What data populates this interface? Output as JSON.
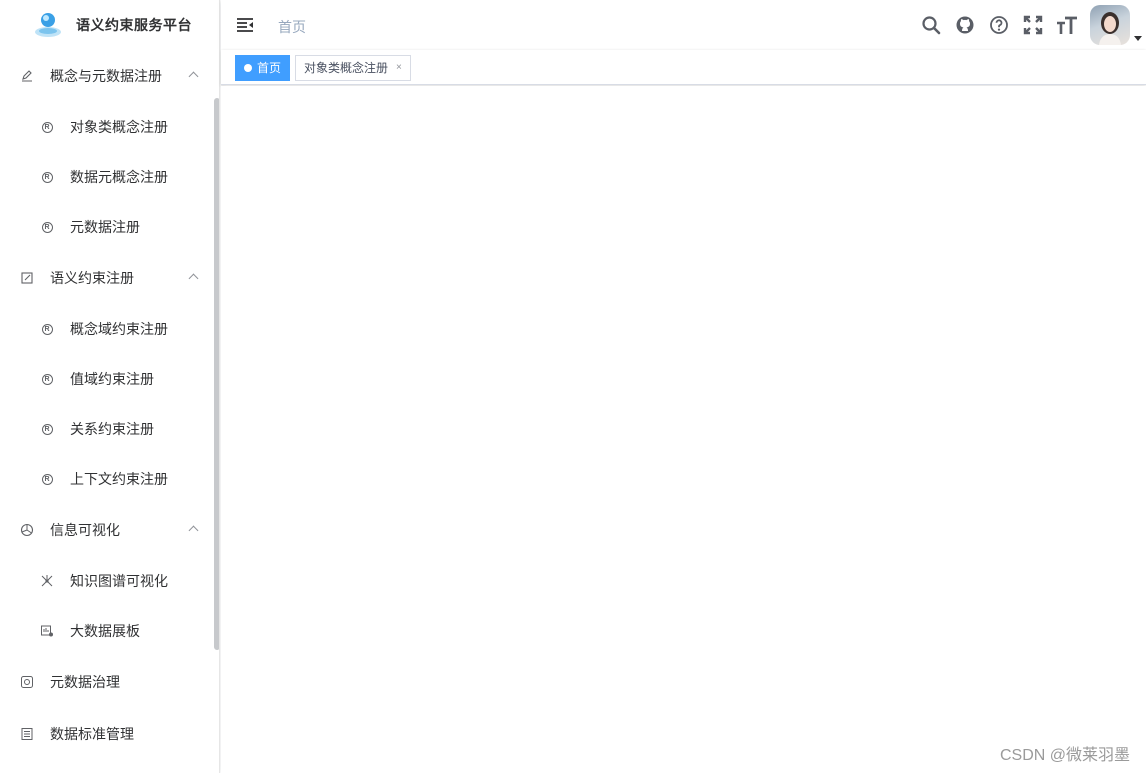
{
  "app": {
    "title": "语义约束服务平台"
  },
  "sidebar": {
    "groups": [
      {
        "label": "概念与元数据注册",
        "items": [
          {
            "label": "对象类概念注册"
          },
          {
            "label": "数据元概念注册"
          },
          {
            "label": "元数据注册"
          }
        ]
      },
      {
        "label": "语义约束注册",
        "items": [
          {
            "label": "概念域约束注册"
          },
          {
            "label": "值域约束注册"
          },
          {
            "label": "关系约束注册"
          },
          {
            "label": "上下文约束注册"
          }
        ]
      },
      {
        "label": "信息可视化",
        "items": [
          {
            "label": "知识图谱可视化"
          },
          {
            "label": "大数据展板"
          }
        ]
      },
      {
        "label": "元数据治理"
      },
      {
        "label": "数据标准管理"
      }
    ]
  },
  "navbar": {
    "breadcrumb": "首页",
    "icons": [
      "search-icon",
      "github-icon",
      "help-icon",
      "fullscreen-icon",
      "font-size-icon"
    ]
  },
  "tags": [
    {
      "label": "首页",
      "active": true
    },
    {
      "label": "对象类概念注册",
      "close": "×"
    }
  ],
  "watermark": "CSDN @微莱羽墨",
  "colors": {
    "accent": "#409eff",
    "text": "#303133",
    "muted": "#97a8be"
  }
}
